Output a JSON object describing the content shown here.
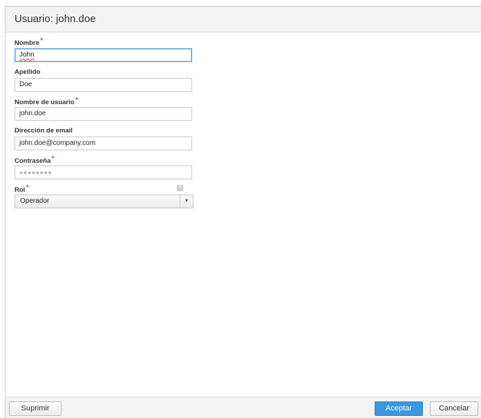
{
  "dialog": {
    "title": "Usuario: john.doe"
  },
  "fields": {
    "first_name": {
      "label": "Nombre",
      "required": "*",
      "value": "John"
    },
    "last_name": {
      "label": "Apellido",
      "value": "Doe"
    },
    "username": {
      "label": "Nombre de usuario",
      "required": "*",
      "value": "john.doe"
    },
    "email": {
      "label": "Dirección de email",
      "value": "john.doe@company.com"
    },
    "password": {
      "label": "Contraseña",
      "required": "*",
      "value": "●●●●●●●●"
    },
    "role": {
      "label": "Rol",
      "required": "*",
      "value": "Operador",
      "help_icon": "?"
    }
  },
  "footer": {
    "delete_label": "Suprimir",
    "accept_label": "Aceptar",
    "cancel_label": "Cancelar"
  },
  "colors": {
    "accent": "#3d96e0",
    "required": "#d0342c",
    "focus_border": "#5b9bd5"
  },
  "icons": {
    "role_help": "help-icon",
    "role_dropdown": "chevron-down-icon"
  }
}
